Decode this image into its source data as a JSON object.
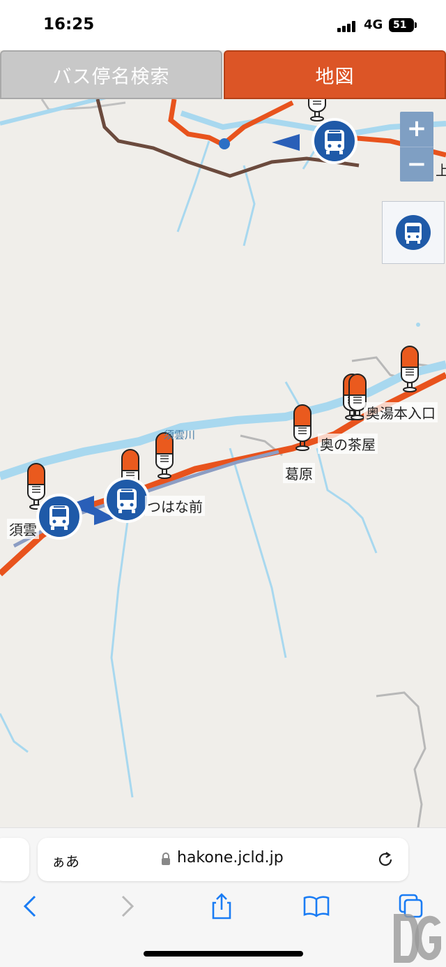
{
  "status_bar": {
    "time": "16:25",
    "network": "4G",
    "battery": "51"
  },
  "tabs": {
    "search_label": "バス停名検索",
    "map_label": "地図"
  },
  "map": {
    "zoom_in": "+",
    "zoom_out": "−",
    "edge_label": "上",
    "river_label": "須雲川",
    "stop_labels": [
      "奥湯本入口",
      "奥の茶屋",
      "葛原",
      "つはな前",
      "須雲"
    ]
  },
  "browser": {
    "text_size": "ぁあ",
    "url": "hakone.jcld.jp"
  },
  "colors": {
    "accent": "#dc5526",
    "bus_blue": "#1e5bab",
    "route_orange": "#e8531d",
    "river": "#a8d8ef"
  }
}
